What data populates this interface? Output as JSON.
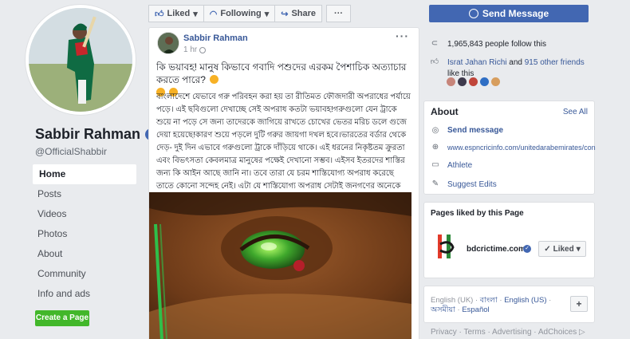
{
  "page": {
    "name": "Sabbir Rahman",
    "handle": "@OfficialShabbir"
  },
  "nav": [
    {
      "label": "Home"
    },
    {
      "label": "Posts"
    },
    {
      "label": "Videos"
    },
    {
      "label": "Photos"
    },
    {
      "label": "About"
    },
    {
      "label": "Community"
    },
    {
      "label": "Info and ads"
    }
  ],
  "create_page_label": "Create a Page",
  "actions": {
    "liked": "Liked",
    "following": "Following",
    "share": "Share",
    "more": "···",
    "send_message": "Send Message"
  },
  "post": {
    "author": "Sabbir Rahman",
    "time": "1 hr",
    "more": "···",
    "headline": "কি ভয়াবহ! মানুষ কিভাবে গবাদি পশুদের এরকম পৈশাচিক অত্যাচার করতে পারে?",
    "body": "বাংলাদেশে যেভাবে গরু পরিবহন করা হয় তা রীতিমত ফৌজদারী অপরাধের পর্যায়ে পড়ে। এই ছবিগুলো দেখাচ্ছে সেই অপরাধ কতটা ভয়াবহ!গরুগুলো যেন ট্রাকে শুয়ে না পড়ে সে জন্য তাদেরকে জাগিয়ে রাখতে চোখের ভেতর মরিচ ডলে গুজে দেয়া হয়েছে!কারণ শুয়ে পড়লে দুটি গরুর জায়গা দখল হবে।ভারতের বর্ডার থেকে দেড়- দুই দিন এভাবে গরুগুলো ট্রাকে দাঁড়িয়ে থাকে। এই ধরনের নিকৃষ্টতম ক্রুরতা এবং বিভৎসতা কেবলমাত্র মানুষের পক্ষেই দেখানো সম্ভব। এইসব ইতরদের শাস্তির জন্য কি আইন আছে জানি না। তবে তারা যে চরম শাস্তিযোগ্য অপরাধ করেছে তাতে কোনো সন্দেহ নেই। এটা যে শাস্তিযোগ্য অপরাধ সেটাই জনগণের অনেকে বোঝে না।"
  },
  "sidebar": {
    "followers": "1,965,843 people follow this",
    "friends_prefix": "Israt Jahan Richi",
    "friends_and": " and ",
    "friends_count": "915 other friends",
    "friends_suffix": " like this",
    "about_title": "About",
    "see_all": "See All",
    "about_items": [
      {
        "label": "Send message",
        "icon": "messenger-icon"
      },
      {
        "label": "www.espncricinfo.com/unitedarabemirates/con",
        "icon": "globe-icon"
      },
      {
        "label": "Athlete",
        "icon": "page-icon"
      },
      {
        "label": "Suggest Edits",
        "icon": "pencil-icon"
      }
    ],
    "pages_title": "Pages liked by this Page",
    "liked_page": "bdcrictime.com",
    "liked_btn": "Liked",
    "languages": [
      "English (UK)",
      "বাংলা",
      "English (US)",
      "অসমীয়া",
      "Español"
    ],
    "footer": "Privacy · Terms · Advertising · AdChoices ▷"
  },
  "colors": {
    "brand": "#4267b2",
    "link": "#385898",
    "create_green": "#42b72a"
  }
}
